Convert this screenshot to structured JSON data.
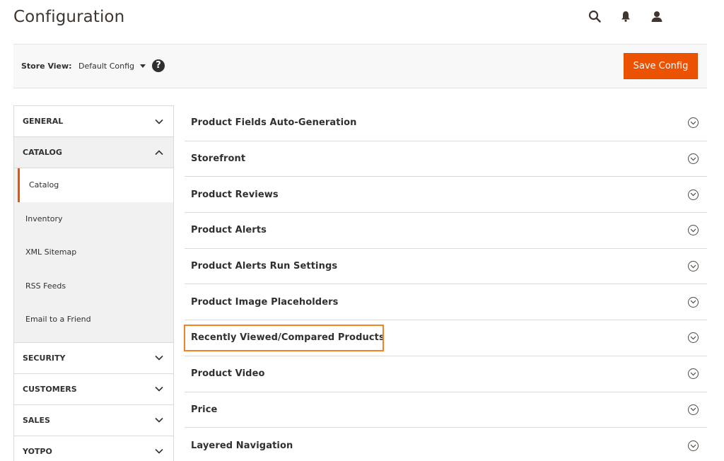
{
  "page": {
    "title": "Configuration"
  },
  "header": {
    "icons": [
      "search-icon",
      "bell-icon",
      "user-icon"
    ]
  },
  "store_bar": {
    "label": "Store View:",
    "selected": "Default Config",
    "help_symbol": "?",
    "save_label": "Save Config"
  },
  "sidebar": {
    "groups_top": [
      {
        "label": "GENERAL",
        "expanded": false
      },
      {
        "label": "CATALOG",
        "expanded": true
      }
    ],
    "catalog_items": [
      {
        "label": "Catalog",
        "active": true
      },
      {
        "label": "Inventory"
      },
      {
        "label": "XML Sitemap"
      },
      {
        "label": "RSS Feeds"
      },
      {
        "label": "Email to a Friend"
      }
    ],
    "groups_bottom": [
      {
        "label": "SECURITY"
      },
      {
        "label": "CUSTOMERS"
      },
      {
        "label": "SALES"
      },
      {
        "label": "YOTPO"
      }
    ]
  },
  "sections": [
    {
      "label": "Product Fields Auto-Generation"
    },
    {
      "label": "Storefront"
    },
    {
      "label": "Product Reviews"
    },
    {
      "label": "Product Alerts"
    },
    {
      "label": "Product Alerts Run Settings"
    },
    {
      "label": "Product Image Placeholders"
    },
    {
      "label": "Recently Viewed/Compared Products",
      "highlighted": true
    },
    {
      "label": "Product Video"
    },
    {
      "label": "Price"
    },
    {
      "label": "Layered Navigation"
    }
  ],
  "colors": {
    "accent": "#eb5202",
    "highlight": "#f58220",
    "text": "#303030"
  }
}
